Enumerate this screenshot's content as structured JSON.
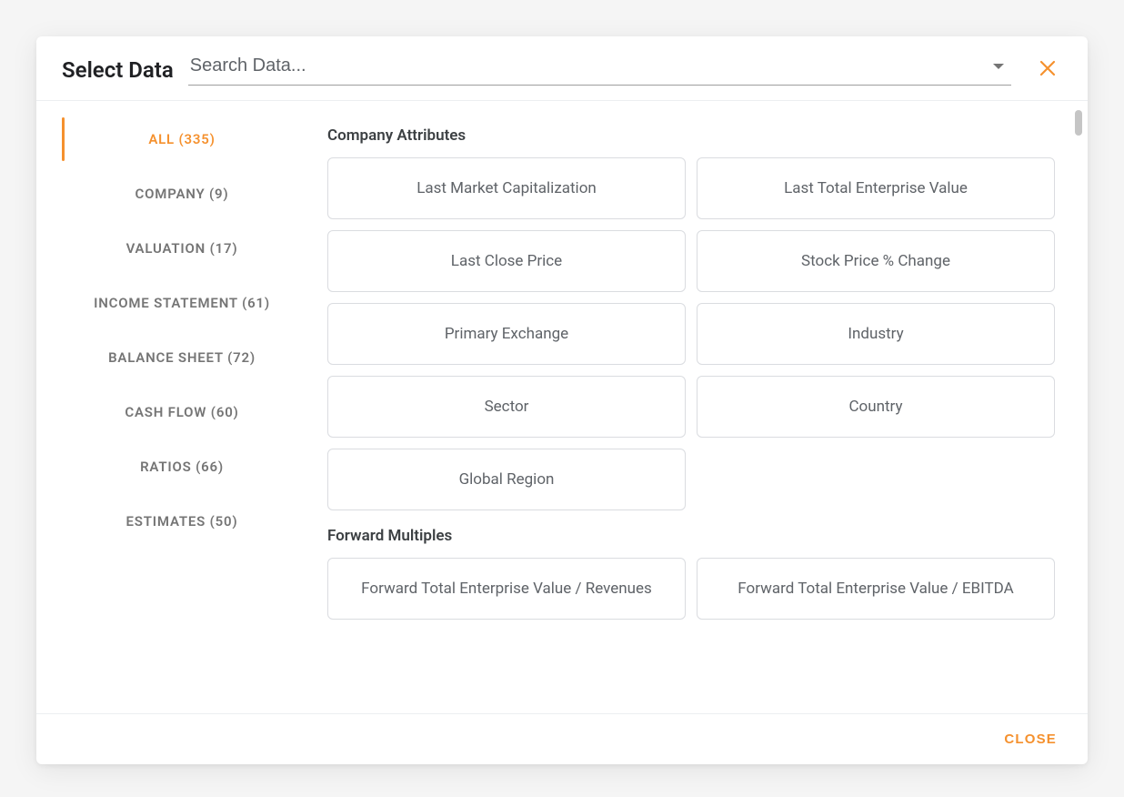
{
  "modal": {
    "title": "Select Data",
    "search": {
      "placeholder": "Search Data..."
    },
    "footer": {
      "close_label": "CLOSE"
    }
  },
  "categories": [
    {
      "label": "ALL (335)",
      "active": true
    },
    {
      "label": "COMPANY (9)",
      "active": false
    },
    {
      "label": "VALUATION (17)",
      "active": false
    },
    {
      "label": "INCOME STATEMENT (61)",
      "active": false
    },
    {
      "label": "BALANCE SHEET (72)",
      "active": false
    },
    {
      "label": "CASH FLOW (60)",
      "active": false
    },
    {
      "label": "RATIOS (66)",
      "active": false
    },
    {
      "label": "ESTIMATES (50)",
      "active": false
    }
  ],
  "sections": [
    {
      "title": "Company Attributes",
      "items": [
        "Last Market Capitalization",
        "Last Total Enterprise Value",
        "Last Close Price",
        "Stock Price % Change",
        "Primary Exchange",
        "Industry",
        "Sector",
        "Country",
        "Global Region"
      ]
    },
    {
      "title": "Forward Multiples",
      "items": [
        "Forward Total Enterprise Value / Revenues",
        "Forward Total Enterprise Value / EBITDA"
      ]
    }
  ],
  "colors": {
    "accent": "#f5912e"
  }
}
